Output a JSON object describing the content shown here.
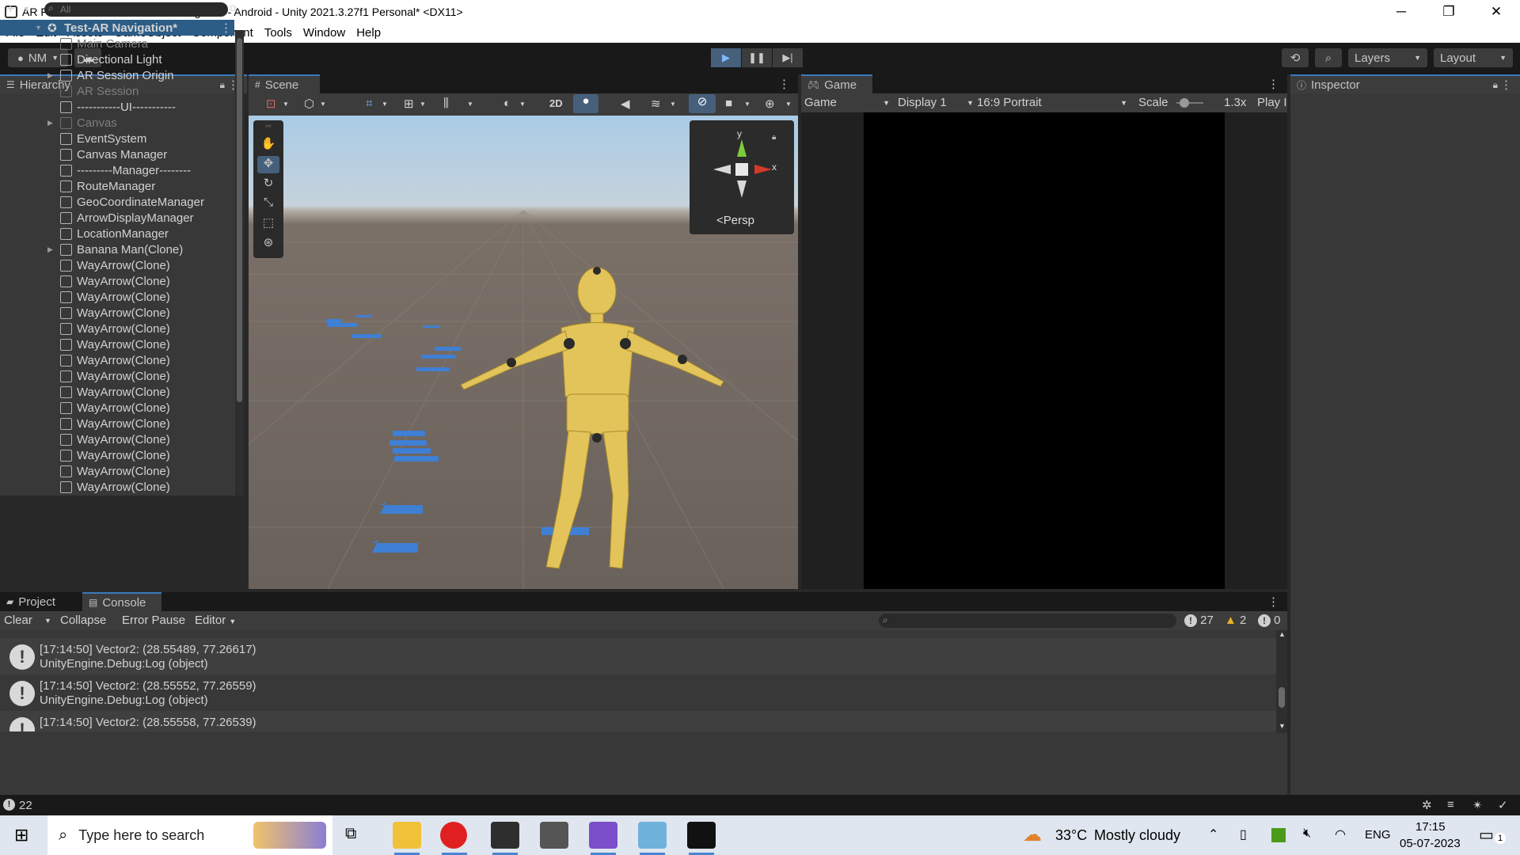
{
  "window": {
    "title": "AR Foundation-Test - Test-AR Navigation - Android - Unity 2021.3.27f1 Personal* <DX11>",
    "controls": [
      "─",
      "❐",
      "✕"
    ]
  },
  "menu": [
    "File",
    "Edit",
    "Assets",
    "GameObject",
    "Component",
    "Tools",
    "Window",
    "Help"
  ],
  "toolbar": {
    "account": "NM",
    "layers": "Layers",
    "layout": "Layout"
  },
  "hierarchy": {
    "tab": "Hierarchy",
    "search_placeholder": "All",
    "scene": "Test-AR Navigation*",
    "items": [
      {
        "label": "Main Camera",
        "dim": true,
        "expand": false
      },
      {
        "label": "Directional Light",
        "dim": false,
        "expand": false
      },
      {
        "label": "AR Session Origin",
        "dim": false,
        "expand": true
      },
      {
        "label": "AR Session",
        "dim": true,
        "expand": false
      },
      {
        "label": "-----------UI-----------",
        "dim": false,
        "expand": false
      },
      {
        "label": "Canvas",
        "dim": true,
        "expand": true
      },
      {
        "label": "EventSystem",
        "dim": false,
        "expand": false
      },
      {
        "label": "Canvas Manager",
        "dim": false,
        "expand": false
      },
      {
        "label": "---------Manager--------",
        "dim": false,
        "expand": false
      },
      {
        "label": "RouteManager",
        "dim": false,
        "expand": false
      },
      {
        "label": "GeoCoordinateManager",
        "dim": false,
        "expand": false
      },
      {
        "label": "ArrowDisplayManager",
        "dim": false,
        "expand": false
      },
      {
        "label": "LocationManager",
        "dim": false,
        "expand": false
      },
      {
        "label": "Banana Man(Clone)",
        "dim": false,
        "expand": true
      },
      {
        "label": "WayArrow(Clone)",
        "dim": false,
        "expand": false
      },
      {
        "label": "WayArrow(Clone)",
        "dim": false,
        "expand": false
      },
      {
        "label": "WayArrow(Clone)",
        "dim": false,
        "expand": false
      },
      {
        "label": "WayArrow(Clone)",
        "dim": false,
        "expand": false
      },
      {
        "label": "WayArrow(Clone)",
        "dim": false,
        "expand": false
      },
      {
        "label": "WayArrow(Clone)",
        "dim": false,
        "expand": false
      },
      {
        "label": "WayArrow(Clone)",
        "dim": false,
        "expand": false
      },
      {
        "label": "WayArrow(Clone)",
        "dim": false,
        "expand": false
      },
      {
        "label": "WayArrow(Clone)",
        "dim": false,
        "expand": false
      },
      {
        "label": "WayArrow(Clone)",
        "dim": false,
        "expand": false
      },
      {
        "label": "WayArrow(Clone)",
        "dim": false,
        "expand": false
      },
      {
        "label": "WayArrow(Clone)",
        "dim": false,
        "expand": false
      },
      {
        "label": "WayArrow(Clone)",
        "dim": false,
        "expand": false
      },
      {
        "label": "WayArrow(Clone)",
        "dim": false,
        "expand": false
      },
      {
        "label": "WayArrow(Clone)",
        "dim": false,
        "expand": false
      }
    ]
  },
  "scene": {
    "tab": "Scene",
    "mode_2d": "2D",
    "gizmo_y": "y",
    "gizmo_x": "x",
    "projection": "Persp"
  },
  "game": {
    "tab": "Game",
    "view_mode": "Game",
    "display": "Display 1",
    "aspect": "16:9 Portrait",
    "scale_label": "Scale",
    "scale_value": "1.3x",
    "play_label": "Play I"
  },
  "inspector": {
    "tab": "Inspector"
  },
  "console": {
    "tabs": [
      "Project",
      "Console"
    ],
    "clear": "Clear",
    "collapse": "Collapse",
    "error_pause": "Error Pause",
    "editor": "Editor",
    "count_log": "27",
    "count_warn": "2",
    "count_err": "0",
    "entries": [
      {
        "line1": "[17:14:50] Vector2: (28.55489, 77.26617)",
        "line2": "UnityEngine.Debug:Log (object)"
      },
      {
        "line1": "[17:14:50] Vector2: (28.55552, 77.26559)",
        "line2": "UnityEngine.Debug:Log (object)"
      },
      {
        "line1": "[17:14:50] Vector2: (28.55558, 77.26539)",
        "line2": ""
      }
    ]
  },
  "status": {
    "count": "22"
  },
  "taskbar": {
    "search_placeholder": "Type here to search",
    "weather_temp": "33°C",
    "weather_text": "Mostly cloudy",
    "language": "ENG",
    "time": "17:15",
    "date": "05-07-2023",
    "notifications": "1"
  }
}
